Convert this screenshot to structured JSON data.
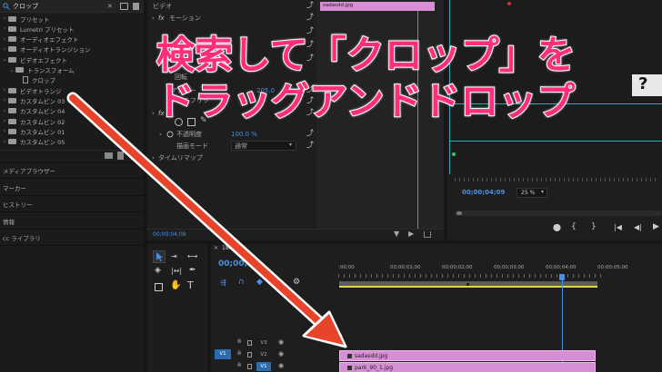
{
  "search": {
    "value": "クロップ"
  },
  "project_tree": [
    {
      "label": "プリセット",
      "indent": 0,
      "kind": "folder"
    },
    {
      "label": "Lumetri プリセット",
      "indent": 0,
      "kind": "folder"
    },
    {
      "label": "オーディオエフェクト",
      "indent": 0,
      "kind": "folder"
    },
    {
      "label": "オーディオトランジション",
      "indent": 0,
      "kind": "folder"
    },
    {
      "label": "ビデオエフェクト",
      "indent": 0,
      "kind": "folder",
      "open": true
    },
    {
      "label": "トランスフォーム",
      "indent": 1,
      "kind": "folder",
      "open": true
    },
    {
      "label": "クロップ",
      "indent": 2,
      "kind": "file"
    },
    {
      "label": "ビデオトランジ",
      "indent": 0,
      "kind": "folder"
    },
    {
      "label": "カスタムビン 03",
      "indent": 0,
      "kind": "folder"
    },
    {
      "label": "カスタムビン 04",
      "indent": 0,
      "kind": "folder"
    },
    {
      "label": "カスタムビン 02",
      "indent": 0,
      "kind": "folder"
    },
    {
      "label": "カスタムビン 01",
      "indent": 0,
      "kind": "folder"
    },
    {
      "label": "カスタムビン 05",
      "indent": 0,
      "kind": "folder"
    }
  ],
  "left_panels": [
    "メディアブラウザー",
    "マーカー",
    "ヒストリー",
    "情報",
    "cc ライブラリ"
  ],
  "effect_controls": {
    "header": "ビデオ",
    "motion": "モーション",
    "rotate": "回転",
    "anchor": "アンカー",
    "anchor_val": "205.0",
    "flicker": "アンチフリッ",
    "opacity_val": "100.0 %",
    "opacity": "不透明度",
    "blend_label": "描画モード",
    "blend_value": "通常",
    "time_remap": "タイムリマップ",
    "time": "00;00;04;09",
    "clip_name": "sadasdd.jpg"
  },
  "program": {
    "time": "00;00;04;09",
    "zoom": "25 %"
  },
  "timeline": {
    "seq_name": "180",
    "time": "00;00;04",
    "ruler": [
      ":00;00",
      "00;00;01;00",
      "00;00;02;00",
      "00;00;03;00",
      "00;00;04;00",
      "00;00;05;00"
    ],
    "tracks": [
      {
        "name": "V3"
      },
      {
        "name": "V2",
        "target": "V1"
      },
      {
        "name": "V1"
      }
    ],
    "clips": [
      {
        "name": "sadasdd.jpg"
      },
      {
        "name": "park_90_1.jpg"
      }
    ]
  },
  "annotation": {
    "line1": "検索して「クロップ」を",
    "line2": "ドラッグアンドドロップ"
  },
  "colors": {
    "accent": "#4a90e2",
    "banner": "#ff2d7a",
    "arrow": "#e8432b",
    "clip": "#d68ed4"
  }
}
